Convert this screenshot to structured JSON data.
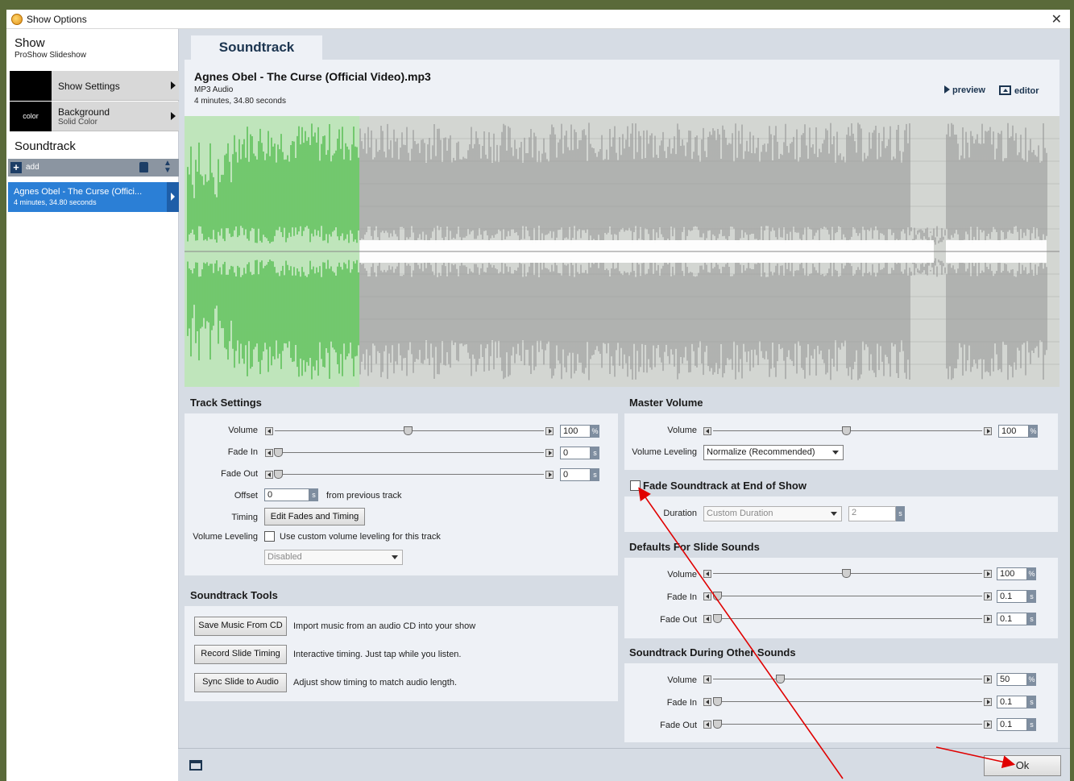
{
  "window": {
    "title": "Show Options",
    "close_glyph": "✕"
  },
  "sidebar": {
    "show_title": "Show",
    "show_subtitle": "ProShow Slideshow",
    "items": [
      {
        "label": "Show Settings",
        "sublabel": ""
      },
      {
        "label": "Background",
        "sublabel": "Solid Color",
        "thumb_text": "color"
      }
    ],
    "soundtrack_title": "Soundtrack",
    "toolbar": {
      "add_label": "add"
    },
    "tracks": [
      {
        "title": "Agnes Obel - The Curse (Offici...",
        "duration": "4 minutes, 34.80 seconds"
      }
    ]
  },
  "tab": {
    "label": "Soundtrack"
  },
  "header": {
    "file_title": "Agnes Obel - The Curse (Official Video).mp3",
    "file_type": "MP3 Audio",
    "duration": "4 minutes, 34.80 seconds",
    "preview_label": "preview",
    "editor_label": "editor"
  },
  "track_settings": {
    "title": "Track Settings",
    "volume_label": "Volume",
    "volume_value": "100",
    "volume_unit": "%",
    "volume_level": 0.5,
    "fade_in_label": "Fade In",
    "fade_in_value": "0",
    "fade_in_unit": "s",
    "fade_out_label": "Fade Out",
    "fade_out_value": "0",
    "fade_out_unit": "s",
    "offset_label": "Offset",
    "offset_value": "0",
    "offset_unit": "s",
    "offset_suffix": "from previous track",
    "timing_label": "Timing",
    "timing_button": "Edit Fades and Timing",
    "leveling_label": "Volume Leveling",
    "leveling_checkbox_label": "Use custom volume leveling for this track",
    "leveling_dropdown": "Disabled"
  },
  "soundtrack_tools": {
    "title": "Soundtrack Tools",
    "tools": [
      {
        "button": "Save Music From CD",
        "desc": "Import music from an audio CD into your show"
      },
      {
        "button": "Record Slide Timing",
        "desc": "Interactive timing. Just tap while you listen."
      },
      {
        "button": "Sync Slide to Audio",
        "desc": "Adjust show timing to match audio length."
      }
    ]
  },
  "master_volume": {
    "title": "Master Volume",
    "volume_label": "Volume",
    "volume_value": "100",
    "volume_unit": "%",
    "leveling_label": "Volume Leveling",
    "leveling_value": "Normalize (Recommended)"
  },
  "fade_end": {
    "title": "Fade Soundtrack at End of Show",
    "duration_label": "Duration",
    "duration_dropdown": "Custom Duration",
    "duration_value": "2",
    "duration_unit": "s"
  },
  "slide_sounds": {
    "title": "Defaults For Slide Sounds",
    "volume_label": "Volume",
    "volume_value": "100",
    "volume_unit": "%",
    "fade_in_label": "Fade In",
    "fade_in_value": "0.1",
    "fade_in_unit": "s",
    "fade_out_label": "Fade Out",
    "fade_out_value": "0.1",
    "fade_out_unit": "s"
  },
  "other_sounds": {
    "title": "Soundtrack During Other Sounds",
    "volume_label": "Volume",
    "volume_value": "50",
    "volume_unit": "%",
    "fade_in_label": "Fade In",
    "fade_in_value": "0.1",
    "fade_in_unit": "s",
    "fade_out_label": "Fade Out",
    "fade_out_value": "0.1",
    "fade_out_unit": "s"
  },
  "footer": {
    "ok_label": "Ok"
  },
  "colors": {
    "accent": "#2b7fd6",
    "played_waveform": "#3fb53a",
    "waveform": "#9a9a9a",
    "annotation": "#e00000"
  },
  "waveform": {
    "played_fraction": 0.2
  }
}
